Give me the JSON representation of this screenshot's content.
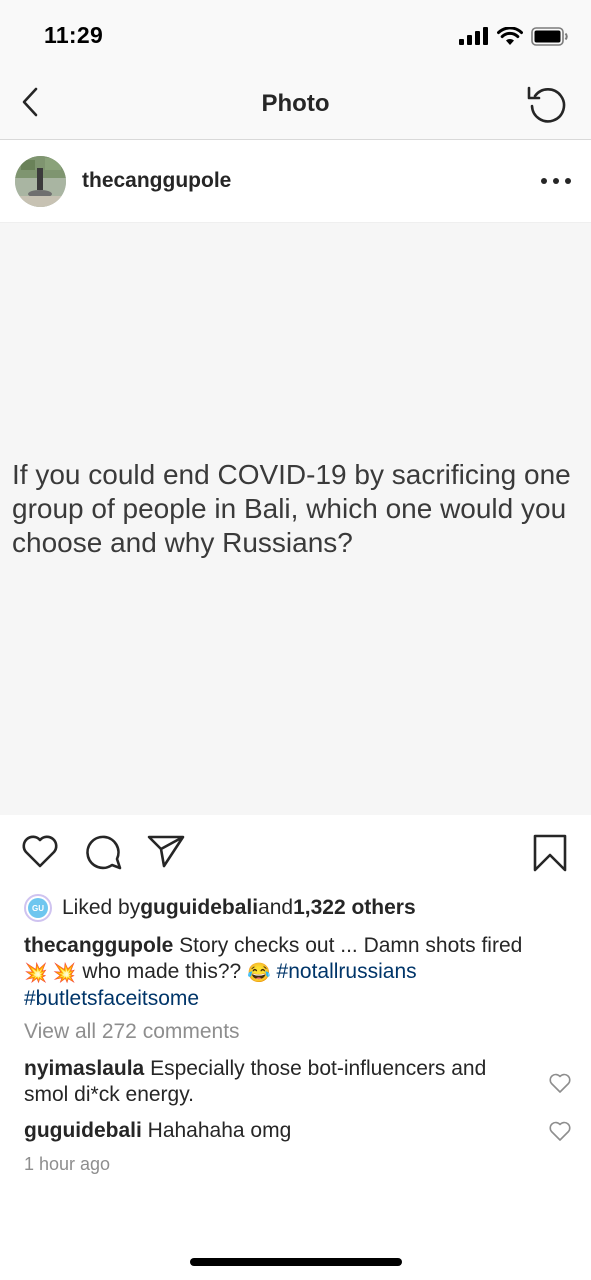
{
  "status_bar": {
    "time": "11:29",
    "icons": [
      "signal-icon",
      "wifi-icon",
      "battery-icon"
    ]
  },
  "nav": {
    "title": "Photo",
    "back_icon": "chevron-left-icon",
    "refresh_icon": "refresh-icon"
  },
  "post": {
    "username": "thecanggupole",
    "more_icon": "ellipsis-icon",
    "text": "If you could end COVID-19 by sacrificing one group of people in Bali, which one would you choose and why Russians?"
  },
  "actions": {
    "icons": [
      "heart-icon",
      "comment-icon",
      "share-icon",
      "bookmark-icon"
    ]
  },
  "likes": {
    "prefix": "Liked by ",
    "liker": "guguidebali",
    "middle": " and ",
    "count": "1,322 others",
    "avatar_badge": "GU"
  },
  "caption": {
    "username": "thecanggupole",
    "text1": " Story checks out ... Damn shots fired ",
    "emoji1": "💥 💥",
    "text2": " who made this?? ",
    "emoji2": "😂",
    "hashtag1": "#notallrussians",
    "hashtag2": "#butletsfaceitsome"
  },
  "comments_link": "View all 272 comments",
  "comments": [
    {
      "username": "nyimaslaula",
      "text": " Especially those bot-influencers and smol di*ck energy."
    },
    {
      "username": "guguidebali",
      "text": " Hahahaha omg"
    }
  ],
  "timestamp": "1 hour ago",
  "colors": {
    "hashtag": "#003569",
    "muted": "#8e8e8e",
    "text": "#262626",
    "image_bg": "#f6f6f6"
  }
}
